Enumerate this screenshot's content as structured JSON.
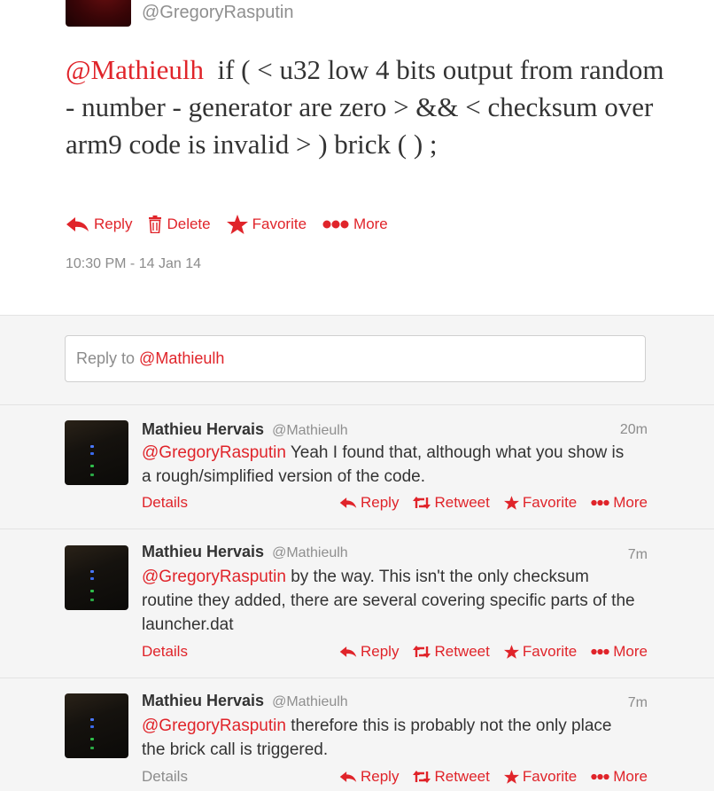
{
  "main_tweet": {
    "handle": "@GregoryRasputin",
    "mention": "@Mathieulh",
    "text": "if ( < u32 low 4 bits output from random - number - generator are zero > && < checksum over arm9 code is invalid > ) brick ( ) ;",
    "actions": {
      "reply": "Reply",
      "delete": "Delete",
      "favorite": "Favorite",
      "more": "More"
    },
    "timestamp": "10:30 PM - 14 Jan 14"
  },
  "reply_box": {
    "prefix": "Reply to ",
    "mention": "@Mathieulh"
  },
  "replies": [
    {
      "name": "Mathieu Hervais",
      "handle": "@Mathieulh",
      "time": "20m",
      "mention": "@GregoryRasputin",
      "text": "Yeah I found that, although what you show is a rough/simplified version of the code.",
      "details": "Details",
      "reply": "Reply",
      "retweet": "Retweet",
      "favorite": "Favorite",
      "more": "More"
    },
    {
      "name": "Mathieu Hervais",
      "handle": "@Mathieulh",
      "time": "7m",
      "mention": "@GregoryRasputin",
      "text": "by the way. This isn't the only checksum routine they added, there are several covering specific parts of the launcher.dat",
      "details": "Details",
      "reply": "Reply",
      "retweet": "Retweet",
      "favorite": "Favorite",
      "more": "More"
    },
    {
      "name": "Mathieu Hervais",
      "handle": "@Mathieulh",
      "time": "7m",
      "mention": "@GregoryRasputin",
      "text": "therefore this is probably not the only place the brick call is triggered.",
      "details": "Details",
      "reply": "Reply",
      "retweet": "Retweet",
      "favorite": "Favorite",
      "more": "More"
    }
  ],
  "colors": {
    "accent": "#e0242a",
    "muted": "#8c8c8c",
    "text": "#333333",
    "background": "#f5f5f5"
  },
  "icons": [
    "reply-arrow-icon",
    "trash-icon",
    "star-icon",
    "more-dots-icon",
    "retweet-icon"
  ]
}
